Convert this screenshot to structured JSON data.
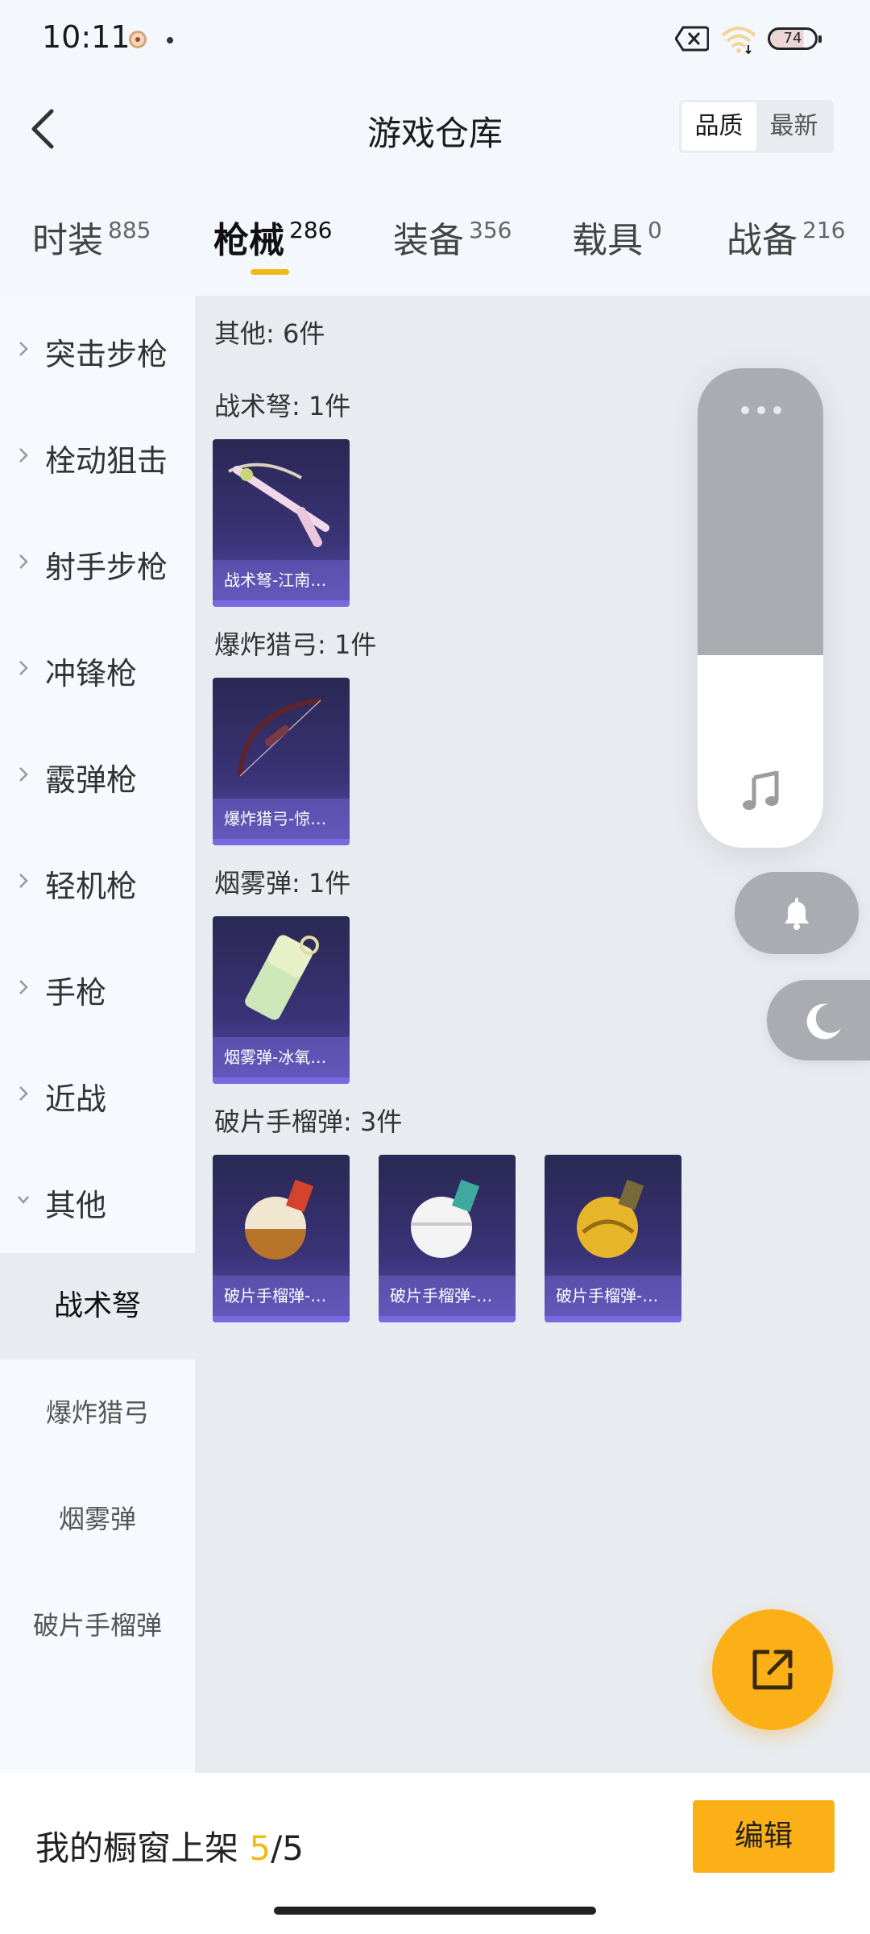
{
  "status_bar": {
    "time": "10:11",
    "battery": "74"
  },
  "header": {
    "title": "游戏仓库",
    "sort_options": [
      "品质",
      "最新"
    ]
  },
  "tabs": [
    {
      "label": "时装",
      "count": "885"
    },
    {
      "label": "枪械",
      "count": "286"
    },
    {
      "label": "装备",
      "count": "356"
    },
    {
      "label": "载具",
      "count": "0"
    },
    {
      "label": "战备",
      "count": "216"
    }
  ],
  "sidebar": {
    "categories": [
      "突击步枪",
      "栓动狙击",
      "射手步枪",
      "冲锋枪",
      "霰弹枪",
      "轻机枪",
      "手枪",
      "近战",
      "其他"
    ],
    "subcategories": [
      "战术弩",
      "爆炸猎弓",
      "烟雾弹",
      "破片手榴弹"
    ]
  },
  "content": {
    "summary": "其他: 6件",
    "groups": [
      {
        "title": "战术弩: 1件",
        "items": [
          "战术弩-江南…"
        ]
      },
      {
        "title": "爆炸猎弓: 1件",
        "items": [
          "爆炸猎弓-惊…"
        ]
      },
      {
        "title": "烟雾弹: 1件",
        "items": [
          "烟雾弹-冰氧…"
        ]
      },
      {
        "title": "破片手榴弹: 3件",
        "items": [
          "破片手榴弹-…",
          "破片手榴弹-…",
          "破片手榴弹-…"
        ]
      }
    ]
  },
  "bottom": {
    "label": "我的橱窗上架",
    "current": "5",
    "total": "/5",
    "edit": "编辑"
  },
  "colors": {
    "accent": "#fbb017",
    "card": "#3a3377"
  }
}
